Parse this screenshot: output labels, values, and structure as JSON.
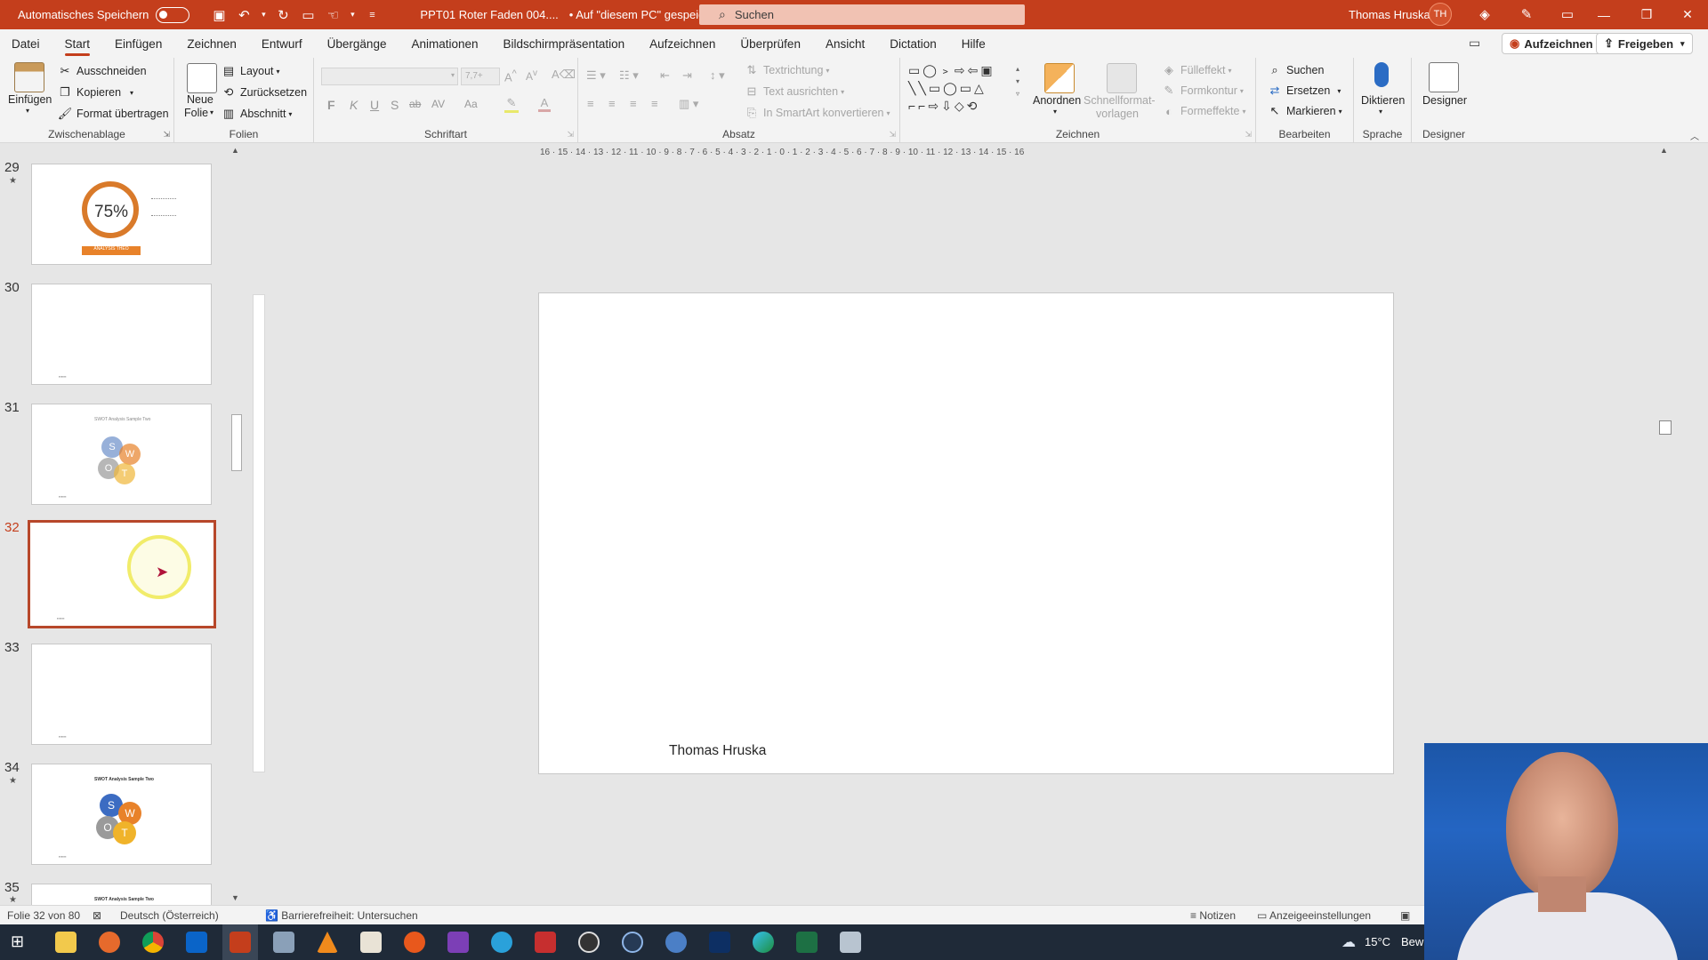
{
  "titlebar": {
    "autosave_label": "Automatisches Speichern",
    "doc_title": "PPT01 Roter Faden 004....",
    "save_status": "• Auf \"diesem PC\" gespeichert",
    "search_placeholder": "Suchen",
    "user_name": "Thomas Hruska",
    "user_initials": "TH"
  },
  "menu": {
    "tabs": [
      "Datei",
      "Start",
      "Einfügen",
      "Zeichnen",
      "Entwurf",
      "Übergänge",
      "Animationen",
      "Bildschirmpräsentation",
      "Aufzeichnen",
      "Überprüfen",
      "Ansicht",
      "Dictation",
      "Hilfe"
    ],
    "active_tab": "Start",
    "record_button": "Aufzeichnen",
    "share_button": "Freigeben"
  },
  "ribbon": {
    "clipboard": {
      "label": "Zwischenablage",
      "paste": "Einfügen",
      "cut": "Ausschneiden",
      "copy": "Kopieren",
      "format_painter": "Format übertragen"
    },
    "slides": {
      "label": "Folien",
      "new_slide_1": "Neue",
      "new_slide_2": "Folie",
      "layout": "Layout",
      "reset": "Zurücksetzen",
      "section": "Abschnitt"
    },
    "font": {
      "label": "Schriftart",
      "size_placeholder": "7,7+",
      "bold": "F",
      "italic": "K",
      "underline": "U",
      "shadow": "S",
      "strike": "ab",
      "spacing": "AV",
      "case": "Aa"
    },
    "paragraph": {
      "label": "Absatz",
      "text_direction": "Textrichtung",
      "align_text": "Text ausrichten",
      "smartart": "In SmartArt konvertieren"
    },
    "drawing": {
      "label": "Zeichnen",
      "arrange": "Anordnen",
      "quick_styles_1": "Schnellformat-",
      "quick_styles_2": "vorlagen",
      "fill": "Fülleffekt",
      "outline": "Formkontur",
      "effects": "Formeffekte"
    },
    "editing": {
      "label": "Bearbeiten",
      "find": "Suchen",
      "replace": "Ersetzen",
      "select": "Markieren"
    },
    "voice": {
      "label": "Sprache",
      "dictate": "Diktieren"
    },
    "designer": {
      "label": "Designer",
      "button": "Designer"
    }
  },
  "thumbnails": [
    {
      "num": "29",
      "star": "★",
      "text": "75%",
      "banner": "ANALYSIS THEO"
    },
    {
      "num": "30",
      "star": "",
      "text": ""
    },
    {
      "num": "31",
      "star": "",
      "title": "SWOT Analysis Sample Two",
      "letters": [
        "S",
        "W",
        "O",
        "T"
      ]
    },
    {
      "num": "32",
      "star": "",
      "active": true
    },
    {
      "num": "33",
      "star": ""
    },
    {
      "num": "34",
      "star": "★",
      "title": "SWOT Analysis Sample Two",
      "letters": [
        "S",
        "W",
        "O",
        "T"
      ]
    },
    {
      "num": "35",
      "star": "★",
      "title": "SWOT Analysis Sample Two"
    }
  ],
  "slide": {
    "footer_text": "Thomas Hruska"
  },
  "ruler": {
    "horizontal": "16 · 15 · 14 · 13 · 12 · 11 · 10 · 9 · 8 · 7 · 6 · 5 · 4 · 3 · 2 · 1 · 0 · 1 · 2 · 3 · 4 · 5 · 6 · 7 · 8 · 9 · 10 · 11 · 12 · 13 · 14 · 15 · 16"
  },
  "statusbar": {
    "slide_info": "Folie 32 von 80",
    "language": "Deutsch (Österreich)",
    "accessibility": "Barrierefreiheit: Untersuchen",
    "notes": "Notizen",
    "display_settings": "Anzeigeeinstellungen"
  },
  "taskbar": {
    "weather": "15°C",
    "weather_text": "Bew"
  },
  "colors": {
    "accent": "#c43e1c",
    "ribbon_bg": "#f3f3f3",
    "canvas_bg": "#e6e6e6"
  }
}
